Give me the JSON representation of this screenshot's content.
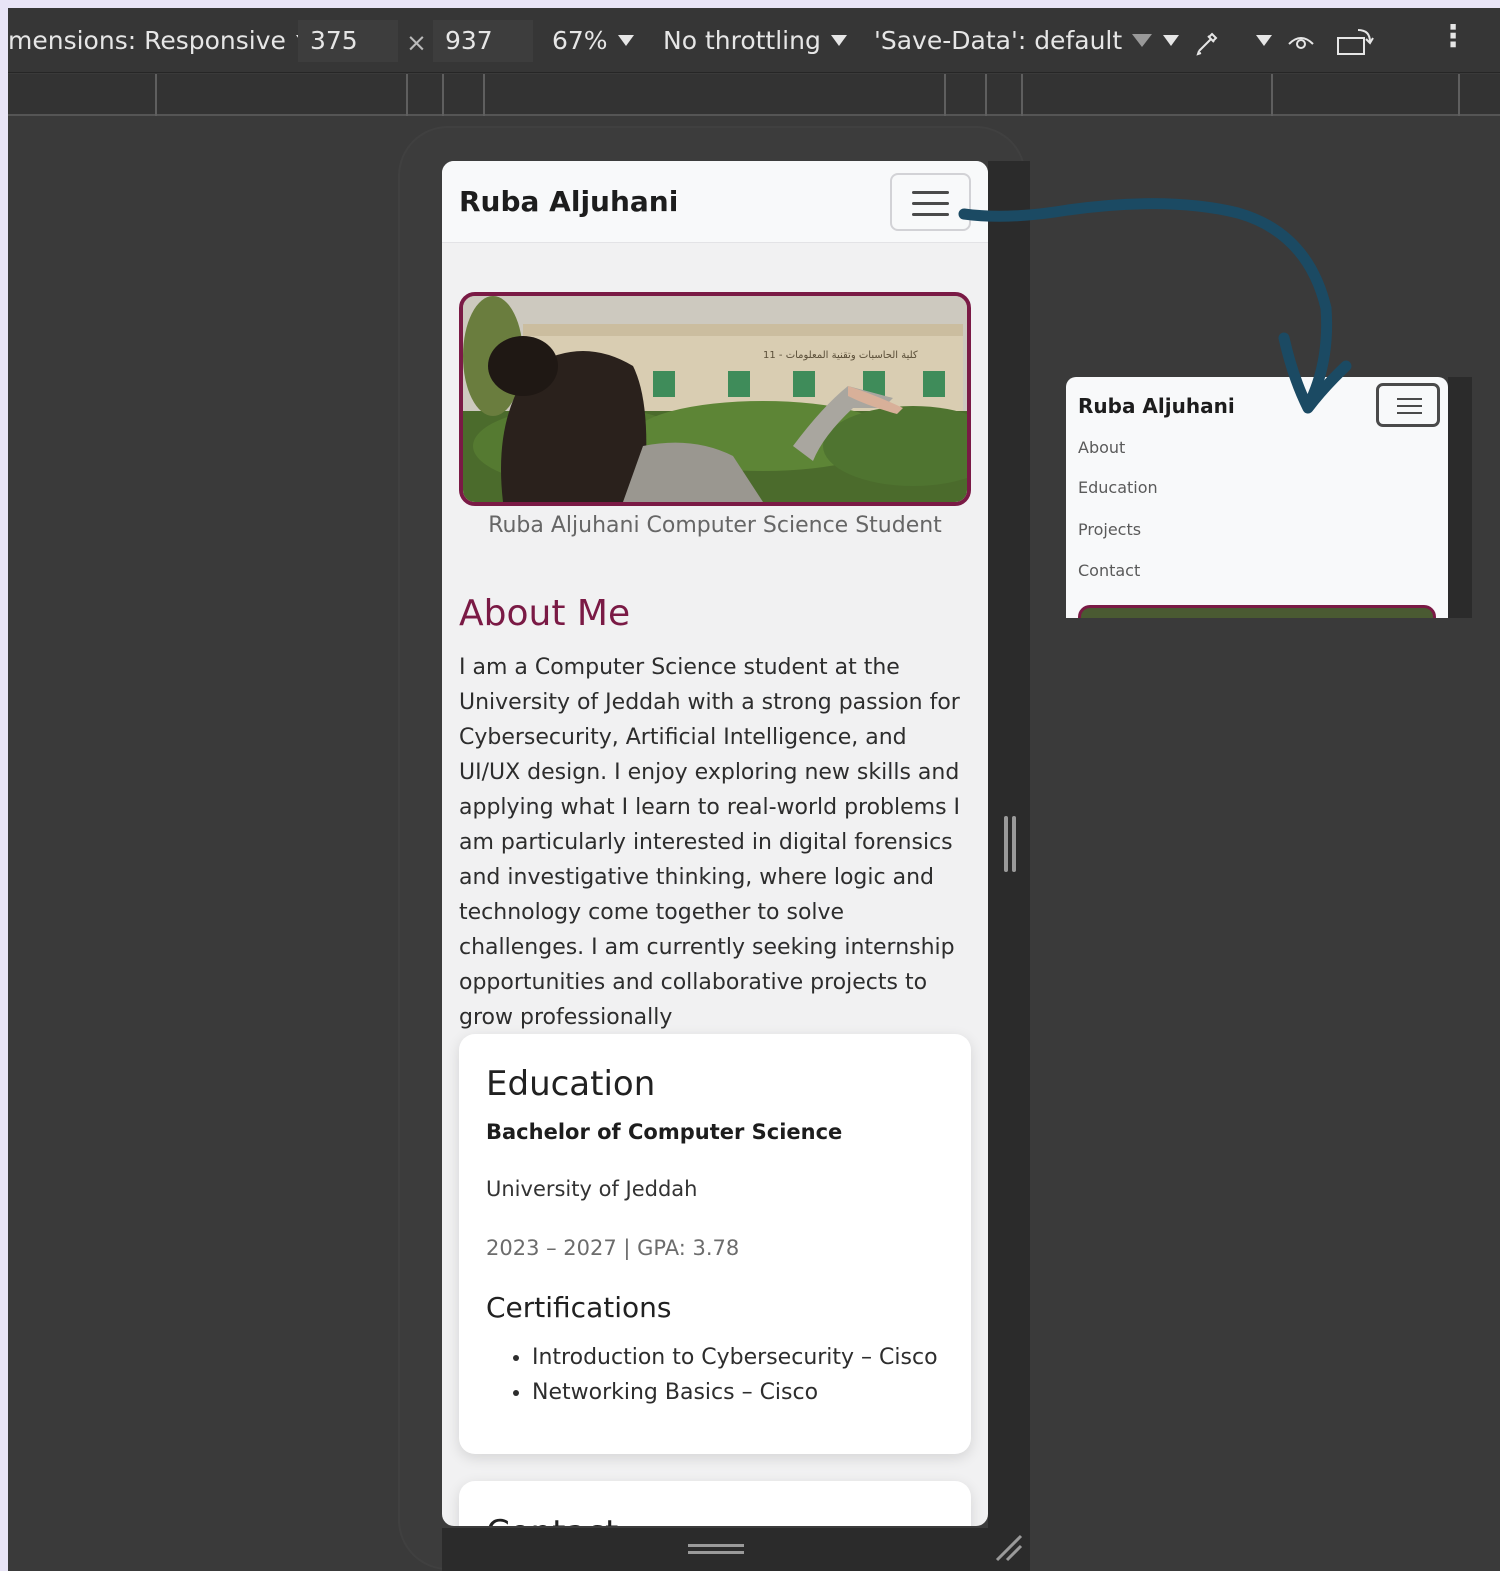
{
  "devtools": {
    "dimensions_label": "mensions: Responsive",
    "width": "375",
    "times": "×",
    "height": "937",
    "zoom": "67%",
    "throttling": "No throttling",
    "save_data": "'Save-Data': default",
    "more": "⋮"
  },
  "site": {
    "brand": "Ruba Aljuhani",
    "hero_caption": "Ruba Aljuhani Computer Science Student",
    "about_title": "About Me",
    "about_text": "I am a Computer Science student at the University of Jeddah with a strong passion for Cybersecurity, Artificial Intelligence, and UI/UX design. I enjoy exploring new skills and applying what I learn to real-world problems I am particularly interested in digital forensics and investigative thinking, where logic and technology come together to solve challenges. I am currently seeking internship opportunities and collaborative projects to grow professionally",
    "education": {
      "title": "Education",
      "degree": "Bachelor of Computer Science",
      "university": "University of Jeddah",
      "years": "2023 – 2027 | GPA: 3.78",
      "cert_title": "Certifications",
      "certs": [
        "Introduction to Cybersecurity – Cisco",
        "Networking Basics – Cisco"
      ]
    },
    "contact_title": "Contact",
    "hero_sign": "11 - كلية الحاسبات وتقنية المعلومات"
  },
  "preview": {
    "brand": "Ruba Aljuhani",
    "menu": [
      "About",
      "Education",
      "Projects",
      "Contact"
    ]
  },
  "colors": {
    "accent": "#7a1a45",
    "arrow": "#1b4a63",
    "devtools_bg": "#3a3a3a",
    "outer_bg": "#e8e4f6"
  }
}
